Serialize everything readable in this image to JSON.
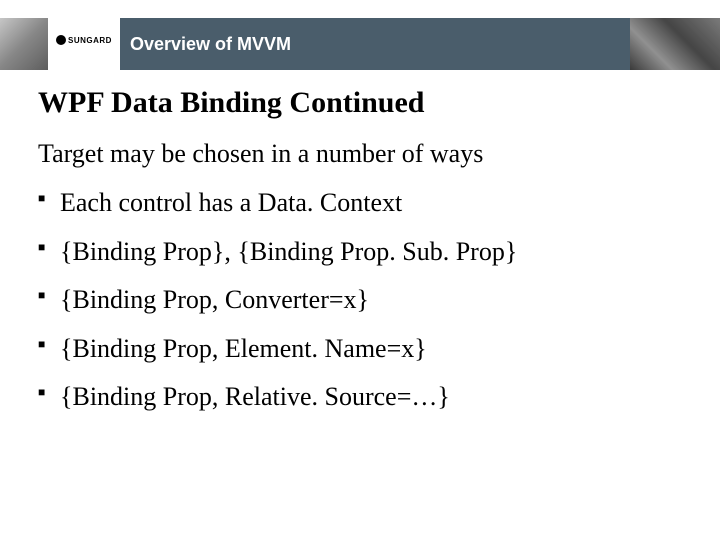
{
  "header": {
    "logo_text": "SUNGARD",
    "title": "Overview of MVVM"
  },
  "content": {
    "main_title": "WPF Data Binding Continued",
    "sub_title": "Target may be chosen in a number of ways",
    "bullets": [
      "Each control has a Data. Context",
      "{Binding Prop}, {Binding Prop. Sub. Prop}",
      "{Binding Prop, Converter=x}",
      "{Binding Prop, Element. Name=x}",
      "{Binding Prop, Relative. Source=…}"
    ]
  }
}
